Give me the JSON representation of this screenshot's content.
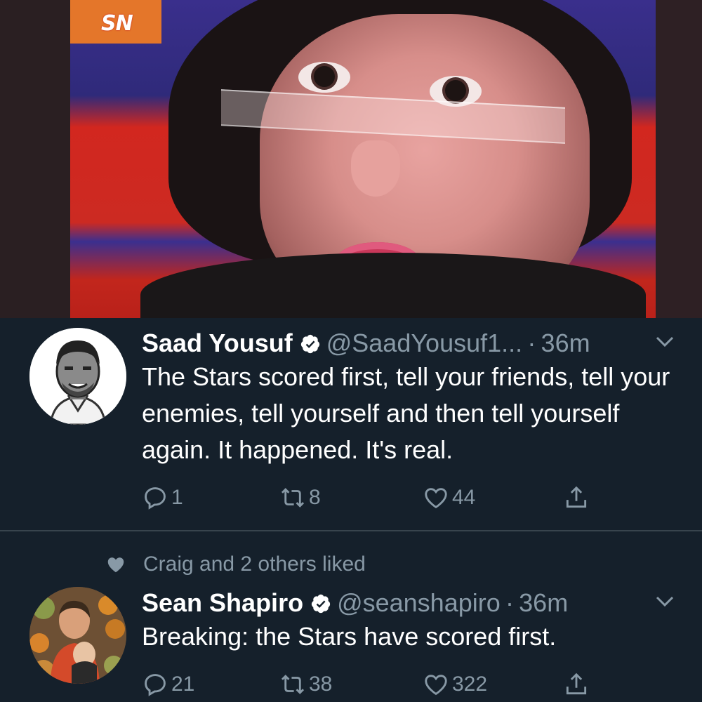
{
  "photo": {
    "broadcaster_logo": "SN",
    "description_icon": "tv-broadcast-photo"
  },
  "tweets": [
    {
      "name": "Saad Yousuf",
      "handle": "@SaadYousuf1...",
      "separator": "·",
      "time": "36m",
      "verified": true,
      "text": "The Stars scored first, tell your friends, tell your enemies, tell yourself and then tell yourself again. It happened. It's real.",
      "replies": "1",
      "retweets": "8",
      "likes": "44"
    },
    {
      "social_context": "Craig and 2 others liked",
      "name": "Sean Shapiro",
      "handle": "@seanshapiro",
      "separator": "·",
      "time": "36m",
      "verified": true,
      "text": "Breaking: the Stars have scored first.",
      "replies": "21",
      "retweets": "38",
      "likes": "322"
    }
  ],
  "colors": {
    "background": "#15202b",
    "secondary_text": "#8899a6",
    "divider": "#38444d",
    "verified_badge": "#ffffff"
  },
  "icons": [
    "reply-icon",
    "retweet-icon",
    "like-icon",
    "share-icon",
    "verified-icon",
    "chevron-down-icon",
    "heart-filled-icon"
  ]
}
